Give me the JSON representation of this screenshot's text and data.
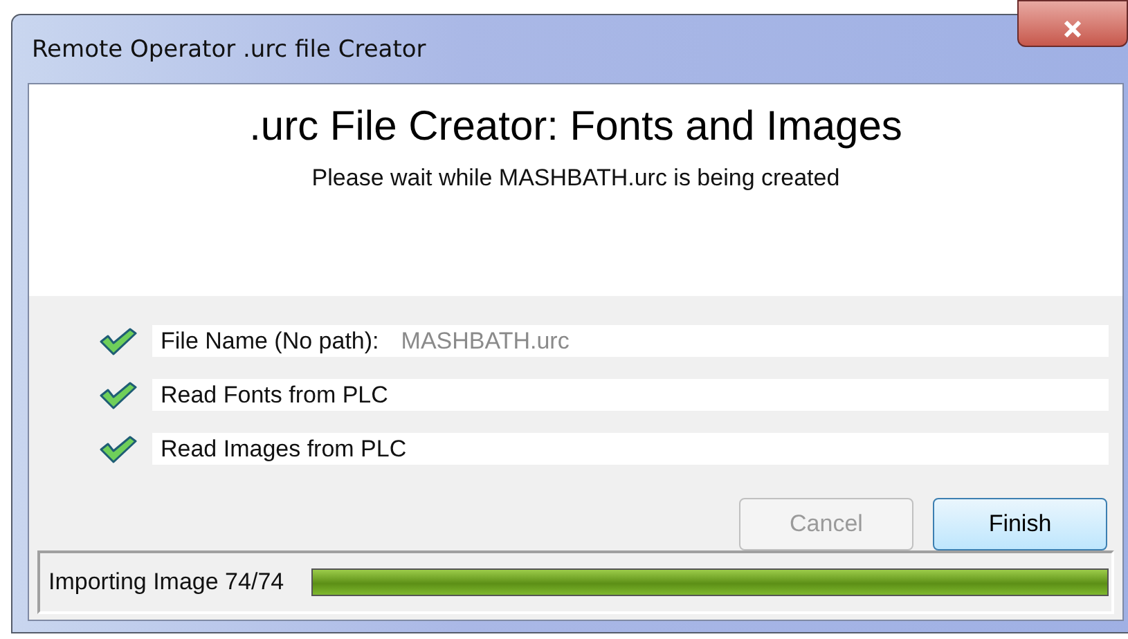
{
  "window": {
    "title": "Remote Operator .urc file Creator"
  },
  "header": {
    "title": ".urc File Creator: Fonts and Images",
    "subtitle": "Please wait while MASHBATH.urc is being created"
  },
  "steps": [
    {
      "label": "File Name (No path):",
      "value": "MASHBATH.urc",
      "done": true
    },
    {
      "label": "Read Fonts from PLC",
      "done": true
    },
    {
      "label": "Read Images from PLC",
      "done": true
    }
  ],
  "buttons": [
    {
      "label": "Cancel",
      "disabled": true,
      "default": false
    },
    {
      "label": "Finish",
      "disabled": false,
      "default": true
    }
  ],
  "status_bar": {
    "text": "Importing Image 74/74",
    "level": 1
  }
}
